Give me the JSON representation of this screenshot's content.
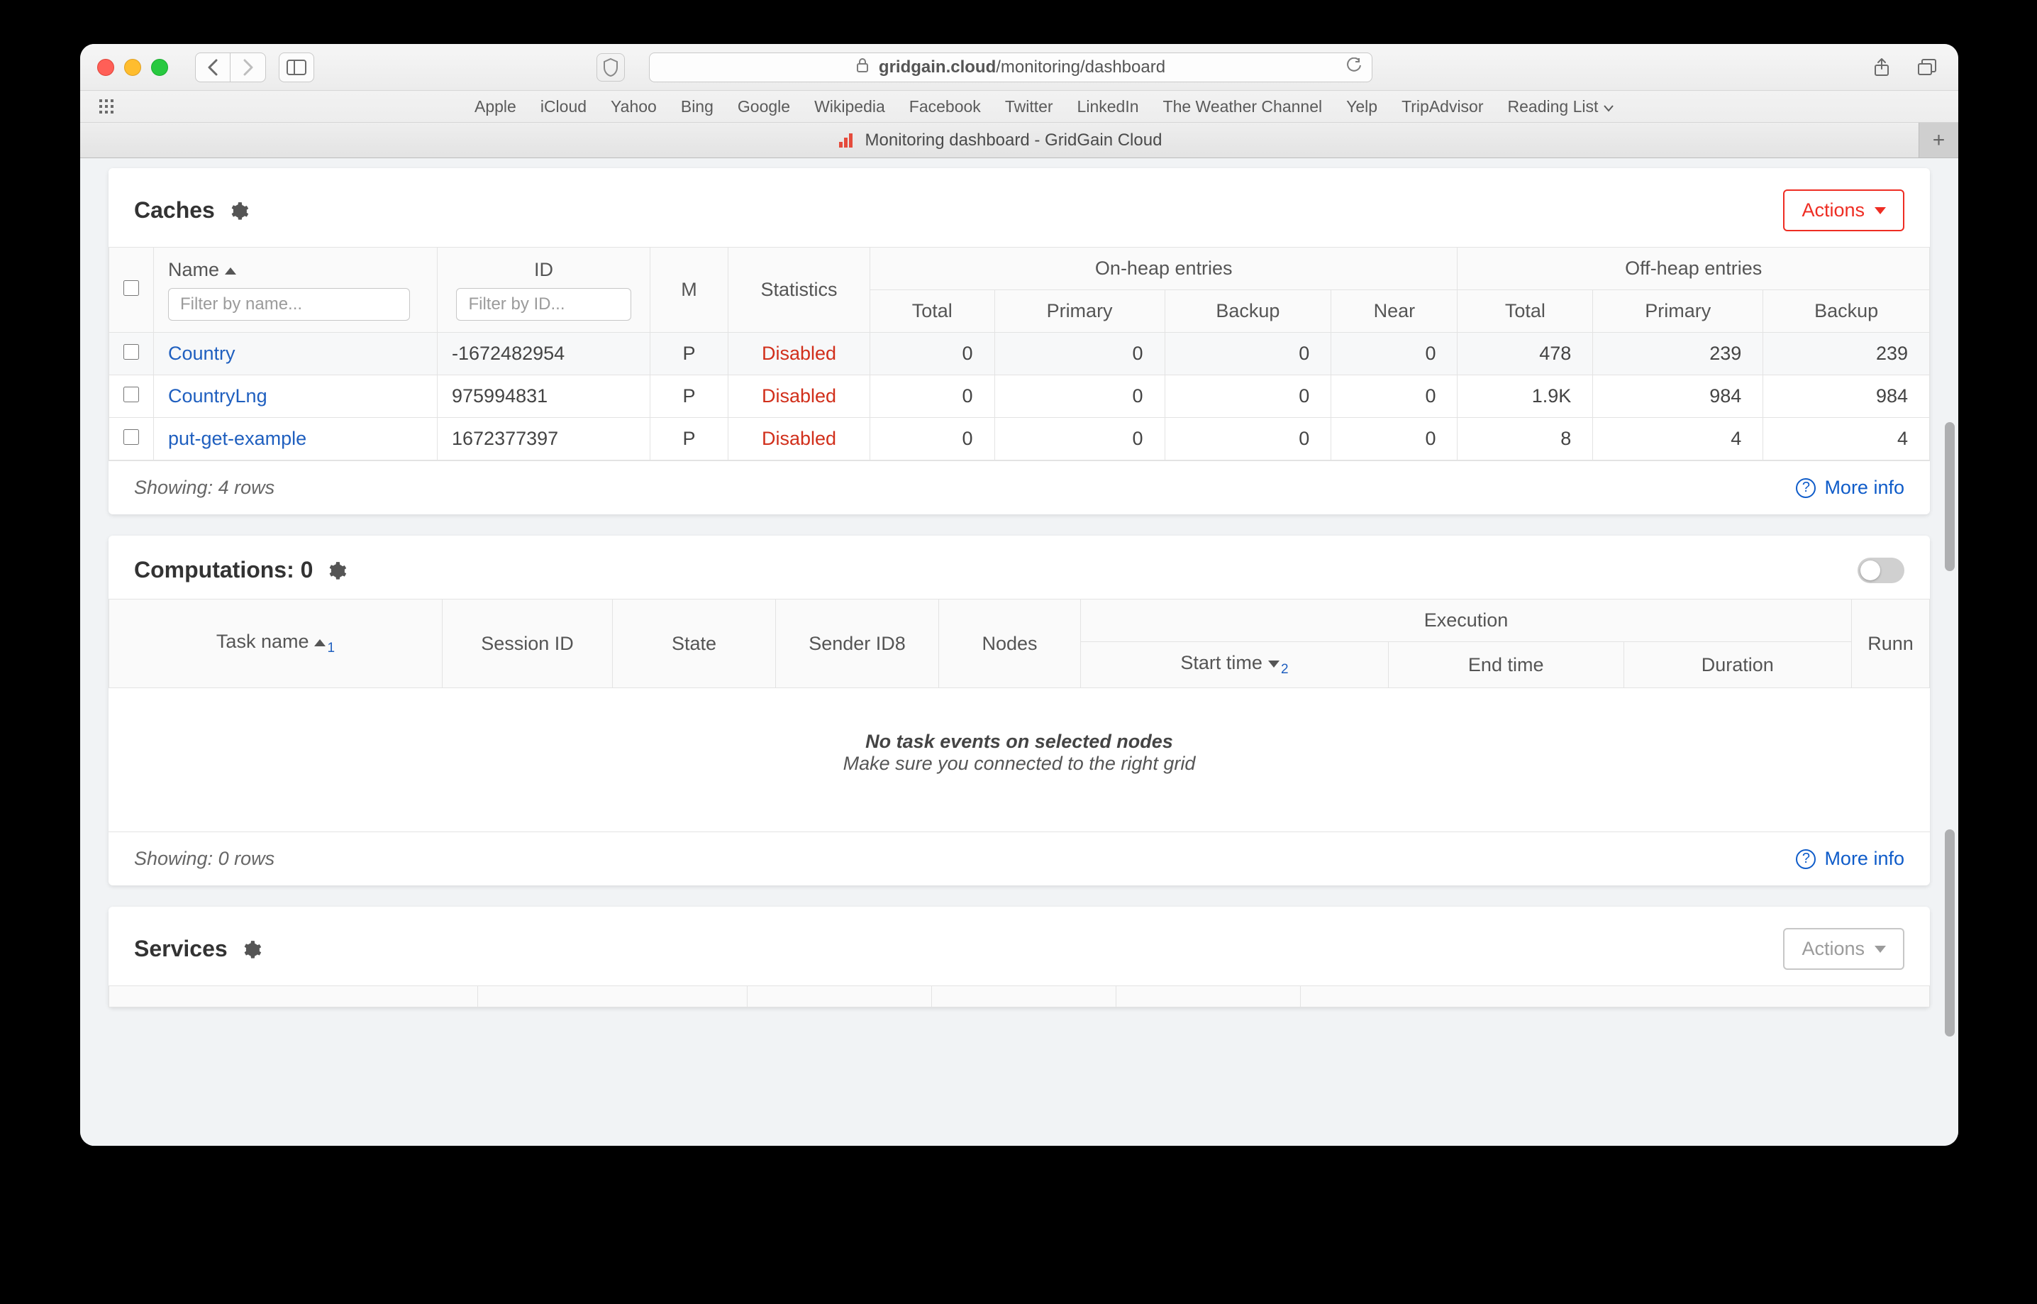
{
  "browser": {
    "url_host": "gridgain.cloud",
    "url_path": "/monitoring/dashboard",
    "favorites": [
      "Apple",
      "iCloud",
      "Yahoo",
      "Bing",
      "Google",
      "Wikipedia",
      "Facebook",
      "Twitter",
      "LinkedIn",
      "The Weather Channel",
      "Yelp",
      "TripAdvisor",
      "Reading List"
    ],
    "tab_title": "Monitoring dashboard - GridGain Cloud"
  },
  "caches": {
    "title": "Caches",
    "actions_label": "Actions",
    "headers": {
      "name": "Name",
      "id": "ID",
      "m": "M",
      "statistics": "Statistics",
      "onheap": "On-heap entries",
      "offheap": "Off-heap entries",
      "total": "Total",
      "primary": "Primary",
      "backup": "Backup",
      "near": "Near"
    },
    "filter_name_placeholder": "Filter by name...",
    "filter_id_placeholder": "Filter by ID...",
    "rows": [
      {
        "name": "Country",
        "id": "-1672482954",
        "m": "P",
        "stats": "Disabled",
        "on_total": "0",
        "on_primary": "0",
        "on_backup": "0",
        "on_near": "0",
        "off_total": "478",
        "off_primary": "239",
        "off_backup": "239",
        "selected": true
      },
      {
        "name": "CountryLng",
        "id": "975994831",
        "m": "P",
        "stats": "Disabled",
        "on_total": "0",
        "on_primary": "0",
        "on_backup": "0",
        "on_near": "0",
        "off_total": "1.9K",
        "off_primary": "984",
        "off_backup": "984",
        "selected": false
      },
      {
        "name": "put-get-example",
        "id": "1672377397",
        "m": "P",
        "stats": "Disabled",
        "on_total": "0",
        "on_primary": "0",
        "on_backup": "0",
        "on_near": "0",
        "off_total": "8",
        "off_primary": "4",
        "off_backup": "4",
        "selected": false
      }
    ],
    "footer_showing": "Showing: 4 rows",
    "more_info": "More info"
  },
  "computations": {
    "title": "Computations: 0",
    "headers": {
      "task_name": "Task name",
      "session_id": "Session ID",
      "state": "State",
      "sender": "Sender ID8",
      "nodes": "Nodes",
      "execution": "Execution",
      "start_time": "Start time",
      "end_time": "End time",
      "duration": "Duration",
      "runn": "Runn"
    },
    "empty_bold": "No task events on selected nodes",
    "empty_sub": "Make sure you connected to the right grid",
    "footer_showing": "Showing: 0 rows",
    "more_info": "More info"
  },
  "services": {
    "title": "Services",
    "actions_label": "Actions"
  }
}
